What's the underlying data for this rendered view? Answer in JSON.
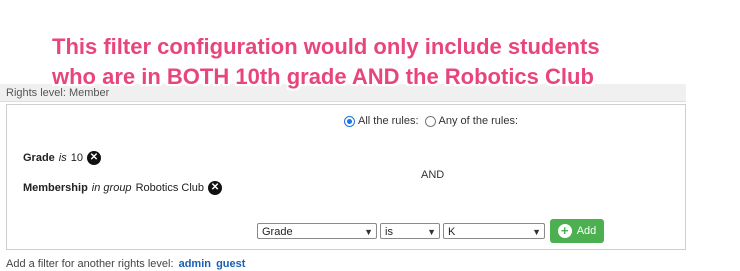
{
  "annotation": {
    "line1": "This filter configuration would only include students",
    "line2": "who are in BOTH 10th grade AND the Robotics Club"
  },
  "section": {
    "header": "Rights level: Member"
  },
  "match": {
    "all_label": "All the rules:",
    "any_label": "Any of the rules:",
    "selected": "all"
  },
  "rules": [
    {
      "field": "Grade",
      "operator": "is",
      "value": "10"
    },
    {
      "field": "Membership",
      "operator": "in group",
      "value": "Robotics Club"
    }
  ],
  "conjunction": "AND",
  "new_rule": {
    "field": "Grade",
    "operator": "is",
    "value": "K",
    "add_label": "Add"
  },
  "footer": {
    "text": "Add a filter for another rights level:",
    "links": [
      "admin",
      "guest"
    ]
  },
  "colors": {
    "annotation": "#e8457f",
    "add_button": "#4caf50",
    "link": "#1a5fb4",
    "radio_selected": "#1a73e8"
  },
  "icons": {
    "remove": "close-circle-icon",
    "add": "plus-circle-icon",
    "dropdown": "chevron-down-icon"
  }
}
